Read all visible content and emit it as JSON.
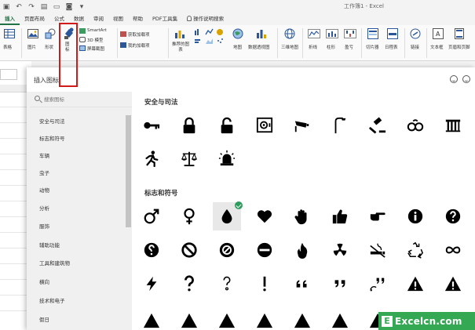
{
  "window": {
    "title": "工作簿1 - Excel"
  },
  "tabs": [
    {
      "label": "插入",
      "active": true
    },
    {
      "label": "页面布局"
    },
    {
      "label": "公式"
    },
    {
      "label": "数据"
    },
    {
      "label": "审阅"
    },
    {
      "label": "视图"
    },
    {
      "label": "帮助"
    },
    {
      "label": "PDF工具集"
    },
    {
      "label": "操作说明搜索"
    }
  ],
  "ribbon": {
    "table": "表格",
    "picture": "图片",
    "shapes": "形状",
    "icons": "图标",
    "smartart": "SmartArt",
    "model3d": "3D 模型",
    "screenshot": "屏幕截图",
    "get_addins": "获取加载项",
    "my_addins": "我的加载项",
    "recommended_charts": "推荐的图表",
    "maps": "地图",
    "pivot_chart": "数据透视图",
    "map3d": "三维地图",
    "line": "折线",
    "column": "柱形",
    "winloss": "盈亏",
    "slicer": "切片器",
    "timeline": "日程表",
    "link": "链接",
    "textbox": "文本框",
    "header_footer": "页眉和页脚"
  },
  "dialog": {
    "title": "插入图标",
    "search_placeholder": "搜索图标",
    "categories": [
      "安全与司法",
      "标志和符号",
      "车辆",
      "虫子",
      "动物",
      "分析",
      "服饰",
      "辅助功能",
      "工具和建筑物",
      "横向",
      "技术和电子",
      "假日"
    ],
    "sections": [
      {
        "title": "安全与司法",
        "icons": [
          "key-icon",
          "lock-icon",
          "unlock-icon",
          "safe-icon",
          "security-camera-icon",
          "street-light-icon",
          "gavel-icon",
          "handcuffs-icon",
          "jail-icon",
          "running-man-icon",
          "scales-icon",
          "siren-icon"
        ]
      },
      {
        "title": "标志和符号",
        "icons": [
          "male-icon",
          "female-icon",
          "drop-icon",
          "heart-icon",
          "hand-stop-icon",
          "thumbs-up-icon",
          "pointing-hand-icon",
          "info-icon",
          "question-circle-icon",
          "question-reversed-icon",
          "no-entry-circle-icon",
          "prohibited-icon",
          "minus-circle-icon",
          "fire-icon",
          "radiation-icon",
          "no-smoking-icon",
          "recycle-icon",
          "infinity-icon",
          "lightning-icon",
          "question-mark-icon",
          "question-mark-outline-icon",
          "exclamation-icon",
          "quote-open-icon",
          "quote-close-icon",
          "quote-bubble-icon",
          "warning-icon",
          "warning-outline-icon"
        ]
      }
    ],
    "selected_icon": "drop-icon"
  },
  "watermark": {
    "letter": "E",
    "text": "Excelcn.com"
  },
  "colors": {
    "accent": "#217346",
    "selection_box": "#d11b1b",
    "check": "#2e9c5e",
    "watermark": "#34a853"
  }
}
